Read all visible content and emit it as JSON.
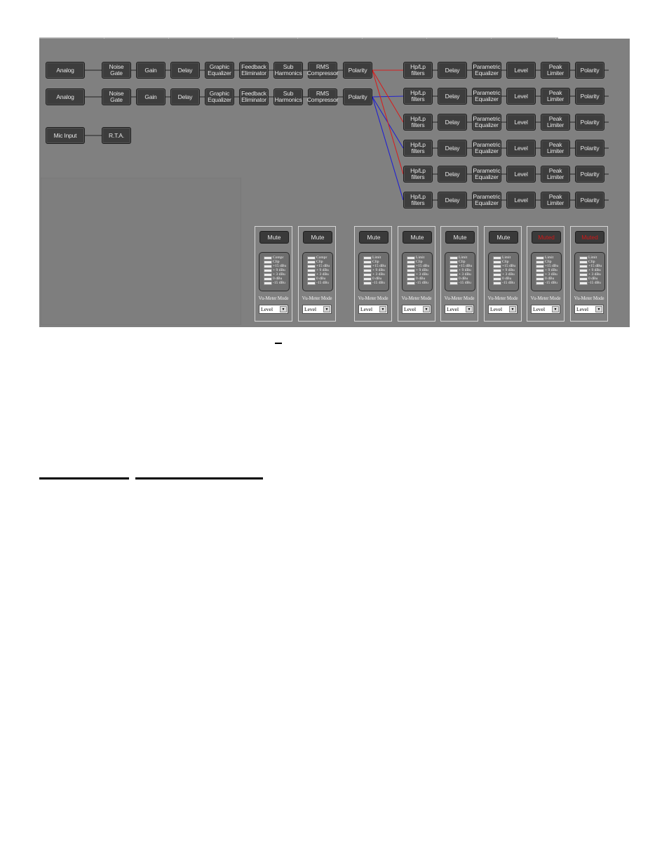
{
  "inputs": [
    {
      "id": "in1",
      "source": "Analog",
      "chain": [
        [
          "Noise Gate"
        ],
        [
          "Gain"
        ],
        [
          "Delay"
        ],
        [
          "Graphic",
          "Equalizer"
        ],
        [
          "Feedback",
          "Eliminator"
        ],
        [
          "Sub",
          "Harmonics"
        ],
        [
          "RMS",
          "Compressor"
        ],
        [
          "Polarity"
        ]
      ],
      "wire_color": "#d42020"
    },
    {
      "id": "in2",
      "source": "Analog",
      "chain": [
        [
          "Noise Gate"
        ],
        [
          "Gain"
        ],
        [
          "Delay"
        ],
        [
          "Graphic",
          "Equalizer"
        ],
        [
          "Feedback",
          "Eliminator"
        ],
        [
          "Sub",
          "Harmonics"
        ],
        [
          "RMS",
          "Compressor"
        ],
        [
          "Polarity"
        ]
      ],
      "wire_color": "#2020d0"
    }
  ],
  "mic": {
    "source": "Mic Input",
    "chain": [
      [
        "R.T.A."
      ]
    ]
  },
  "outputs": [
    {
      "id": "out1",
      "from": "in1",
      "chain": [
        [
          "Hp/Lp",
          "filters"
        ],
        [
          "Delay"
        ],
        [
          "Parametric",
          "Equalizer"
        ],
        [
          "Level"
        ],
        [
          "Peak",
          "Limiter"
        ],
        [
          "Polarity"
        ]
      ]
    },
    {
      "id": "out2",
      "from": "in2",
      "chain": [
        [
          "Hp/Lp",
          "filters"
        ],
        [
          "Delay"
        ],
        [
          "Parametric",
          "Equalizer"
        ],
        [
          "Level"
        ],
        [
          "Peak",
          "Limiter"
        ],
        [
          "Polarity"
        ]
      ]
    },
    {
      "id": "out3",
      "from": "in1",
      "chain": [
        [
          "Hp/Lp",
          "filters"
        ],
        [
          "Delay"
        ],
        [
          "Parametric",
          "Equalizer"
        ],
        [
          "Level"
        ],
        [
          "Peak",
          "Limiter"
        ],
        [
          "Polarity"
        ]
      ]
    },
    {
      "id": "out4",
      "from": "in2",
      "chain": [
        [
          "Hp/Lp",
          "filters"
        ],
        [
          "Delay"
        ],
        [
          "Parametric",
          "Equalizer"
        ],
        [
          "Level"
        ],
        [
          "Peak",
          "Limiter"
        ],
        [
          "Polarity"
        ]
      ]
    },
    {
      "id": "out5",
      "from": "in1",
      "chain": [
        [
          "Hp/Lp",
          "filters"
        ],
        [
          "Delay"
        ],
        [
          "Parametric",
          "Equalizer"
        ],
        [
          "Level"
        ],
        [
          "Peak",
          "Limiter"
        ],
        [
          "Polarity"
        ]
      ]
    },
    {
      "id": "out6",
      "from": "in2",
      "chain": [
        [
          "Hp/Lp",
          "filters"
        ],
        [
          "Delay"
        ],
        [
          "Parametric",
          "Equalizer"
        ],
        [
          "Level"
        ],
        [
          "Peak",
          "Limiter"
        ],
        [
          "Polarity"
        ]
      ]
    }
  ],
  "meters": [
    {
      "channel": "in1",
      "mute_label": "Mute",
      "muted": false,
      "scale": [
        "Compr",
        "Clip",
        "+15 dBu",
        "+ 9 dBu",
        "+ 3 dBu",
        "0 dBu",
        "-15 dBu"
      ],
      "mode_label": "Vu-Meter Mode",
      "mode_value": "Level"
    },
    {
      "channel": "in2",
      "mute_label": "Mute",
      "muted": false,
      "scale": [
        "Compr",
        "Clip",
        "+15 dBu",
        "+ 9 dBu",
        "+ 3 dBu",
        "0 dBu",
        "-15 dBu"
      ],
      "mode_label": "Vu-Meter Mode",
      "mode_value": "Level"
    },
    {
      "channel": "out1",
      "mute_label": "Mute",
      "muted": false,
      "scale": [
        "Limit",
        "Clip",
        "+15 dBu",
        "+ 9 dBu",
        "+ 3 dBu",
        "0 dBu",
        "-15 dBu"
      ],
      "mode_label": "Vu-Meter Mode",
      "mode_value": "Level"
    },
    {
      "channel": "out2",
      "mute_label": "Mute",
      "muted": false,
      "scale": [
        "Limit",
        "Clip",
        "+15 dBu",
        "+ 9 dBu",
        "+ 3 dBu",
        "0 dBu",
        "-15 dBu"
      ],
      "mode_label": "Vu-Meter Mode",
      "mode_value": "Level"
    },
    {
      "channel": "out3",
      "mute_label": "Mute",
      "muted": false,
      "scale": [
        "Limit",
        "Clip",
        "+15 dBu",
        "+ 9 dBu",
        "+ 3 dBu",
        "0 dBu",
        "-15 dBu"
      ],
      "mode_label": "Vu-Meter Mode",
      "mode_value": "Level"
    },
    {
      "channel": "out4",
      "mute_label": "Mute",
      "muted": false,
      "scale": [
        "Limit",
        "Clip",
        "+15 dBu",
        "+ 9 dBu",
        "+ 3 dBu",
        "0 dBu",
        "-15 dBu"
      ],
      "mode_label": "Vu-Meter Mode",
      "mode_value": "Level"
    },
    {
      "channel": "out5",
      "mute_label": "Muted",
      "muted": true,
      "scale": [
        "Limit",
        "Clip",
        "+15 dBu",
        "+ 9 dBu",
        "+ 3 dBu",
        "0 dBu",
        "-15 dBu"
      ],
      "mode_label": "Vu-Meter Mode",
      "mode_value": "Level"
    },
    {
      "channel": "out6",
      "mute_label": "Muted",
      "muted": true,
      "scale": [
        "Limit",
        "Clip",
        "+15 dBu",
        "+ 9 dBu",
        "+ 3 dBu",
        "0 dBu",
        "-15 dBu"
      ],
      "mode_label": "Vu-Meter Mode",
      "mode_value": "Level"
    }
  ],
  "colors": {
    "panel": "#808080",
    "block": "#3d3d3d",
    "muted_text": "#d01818",
    "route_in1": "#d42020",
    "route_in2": "#2020d0"
  }
}
